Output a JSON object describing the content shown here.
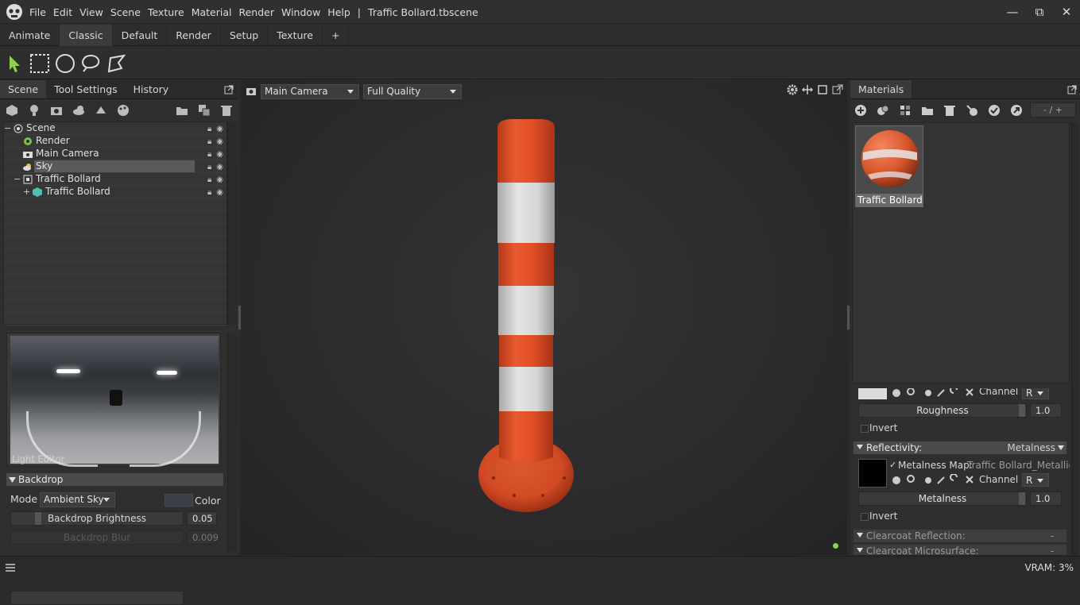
{
  "app": {
    "menu": [
      "File",
      "Edit",
      "View",
      "Scene",
      "Texture",
      "Material",
      "Render",
      "Window",
      "Help"
    ],
    "document_title": "Traffic Bollard.tbscene",
    "separator": "|"
  },
  "window_controls": {
    "minimize": "—",
    "maximize": "⧉",
    "close": "✕"
  },
  "workspace_tabs": [
    "Animate",
    "Classic",
    "Default",
    "Render",
    "Setup",
    "Texture",
    "+"
  ],
  "active_workspace": "Classic",
  "left_panel": {
    "tabs": [
      "Scene",
      "Tool Settings",
      "History"
    ],
    "tree": [
      {
        "label": "Scene",
        "indent": 0,
        "icon": "scene-icon",
        "expander": "−"
      },
      {
        "label": "Render",
        "indent": 1,
        "icon": "render-icon"
      },
      {
        "label": "Main Camera",
        "indent": 1,
        "icon": "camera-icon"
      },
      {
        "label": "Sky",
        "indent": 1,
        "icon": "sky-icon",
        "selected": true
      },
      {
        "label": "Traffic Bollard",
        "indent": 1,
        "icon": "object-icon",
        "expander": "−"
      },
      {
        "label": "Traffic Bollard",
        "indent": 2,
        "icon": "mesh-icon",
        "expander": "+"
      }
    ],
    "light_editor_label": "Light Editor",
    "backdrop": {
      "section": "Backdrop",
      "mode_label": "Mode",
      "mode_value": "Ambient Sky",
      "color_label": "Color",
      "brightness_label": "Backdrop Brightness",
      "brightness_value": "0.05",
      "blur_label": "Backdrop Blur",
      "blur_value": "0.009"
    }
  },
  "viewport": {
    "camera": "Main Camera",
    "quality": "Full Quality",
    "status_color": "#8fd14f"
  },
  "right_panel": {
    "tab": "Materials",
    "pager": "- / +",
    "material_name": "Traffic Bollard",
    "props": {
      "channel_label": "Channel",
      "channel_value": "R",
      "roughness_label": "Roughness",
      "roughness_value": "1.0",
      "invert_label": "Invert",
      "reflectivity_label": "Reflectivity:",
      "reflectivity_value": "Metalness",
      "metalness_map_label": "Metalness Map:",
      "metalness_map_value": "Traffic Bollard_Metallic.",
      "metalness_label": "Metalness",
      "metalness_value": "1.0",
      "clearcoat_reflection": "Clearcoat Reflection:",
      "clearcoat_microsurface": "Clearcoat Microsurface:",
      "dash": "-"
    }
  },
  "status": {
    "vram": "VRAM: 3%"
  },
  "colors": {
    "accent_green": "#8fd14f",
    "bollard_orange": "#e8522a",
    "selection": "#5a5a5a"
  }
}
